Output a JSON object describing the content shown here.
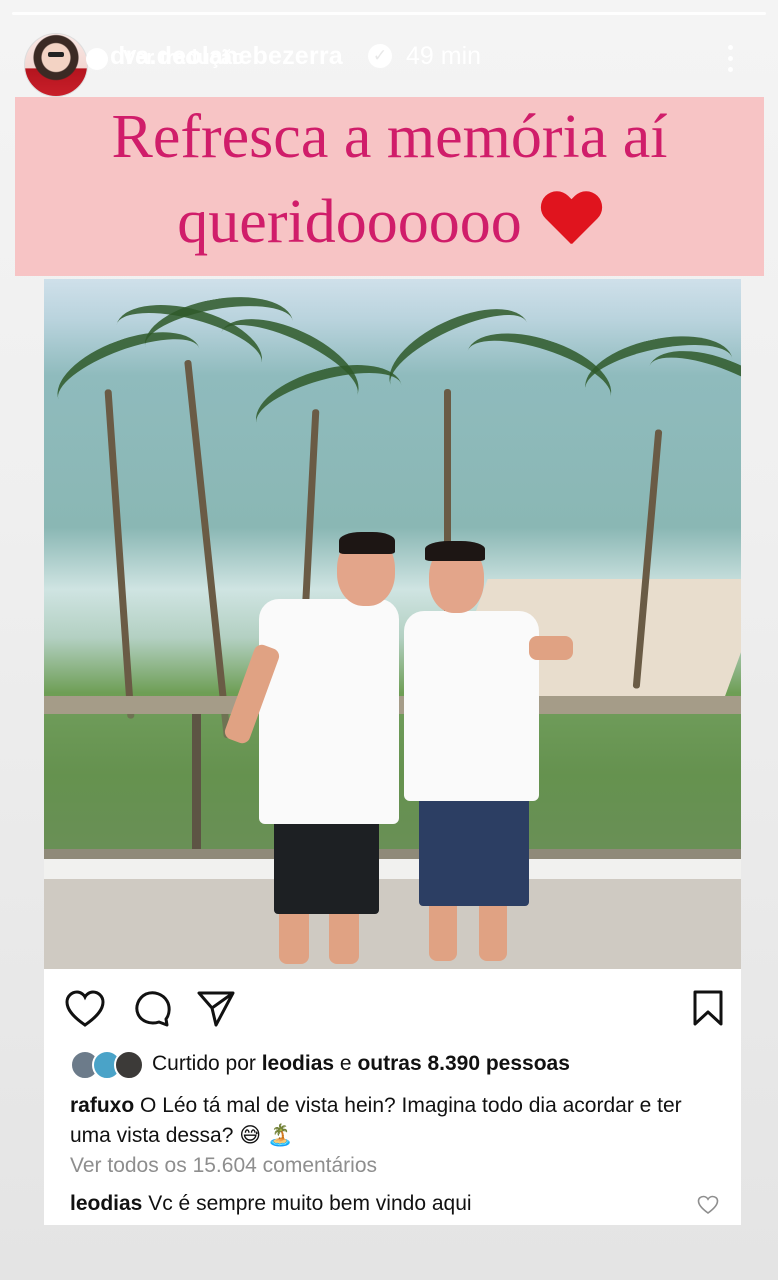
{
  "story": {
    "username": "dra.deolanebezerra",
    "time": "49 min",
    "translate_label": "Ver tradução",
    "verified_mark": "✓"
  },
  "caption": {
    "line1": "Refresca a memória aí",
    "line2": "queridoooooo",
    "emoji": "red-heart",
    "background_color": "#f7c4c5",
    "text_color": "#d01d6a"
  },
  "post": {
    "likes": {
      "prefix": "Curtido por ",
      "user": "leodias",
      "middle": " e ",
      "others": "outras 8.390 pessoas"
    },
    "comment": {
      "user": "rafuxo",
      "text": " O Léo tá mal de vista hein? Imagina todo dia acordar e ter uma vista dessa? 😅 🏝️"
    },
    "view_all_comments": "Ver todos os 15.604 comentários",
    "reply": {
      "user": "leodias",
      "text": " Vc é sempre muito bem vindo aqui"
    }
  }
}
